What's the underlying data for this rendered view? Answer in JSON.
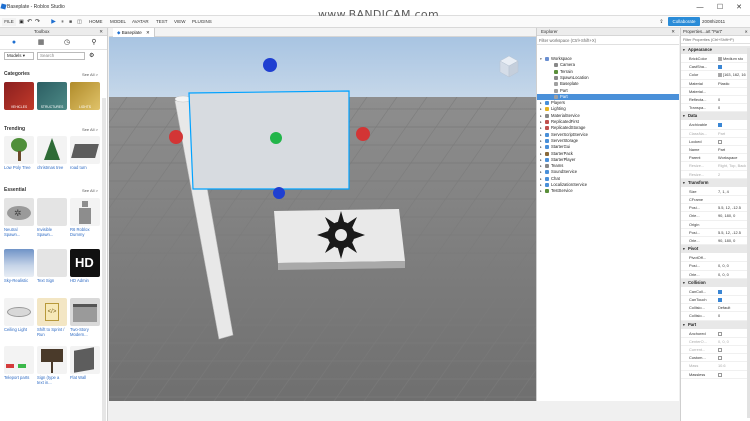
{
  "window": {
    "title": "Baseplate - Roblox Studio",
    "watermark": "www.BANDICAM.com",
    "min": "—",
    "max": "☐",
    "close": "✕"
  },
  "menubar": {
    "file": "FILE",
    "items": [
      "HOME",
      "MODEL",
      "AVATAR",
      "TEST",
      "VIEW",
      "PLUGINS"
    ],
    "collaborate": "Collaborate",
    "user": "2008hi2011"
  },
  "toolbox": {
    "title": "Toolbox",
    "close": "✕",
    "category_select": "Models",
    "search_placeholder": "Search",
    "sections": [
      {
        "title": "Categories",
        "see_all": "See All >"
      },
      {
        "title": "Trending",
        "see_all": "See All >"
      },
      {
        "title": "Essential",
        "see_all": "See All >"
      }
    ],
    "categories": [
      {
        "label": "VEHICLES",
        "color": "#b32b2b"
      },
      {
        "label": "STRUCTURES",
        "color": "#2f6f75"
      },
      {
        "label": "LIGHTS",
        "color": "#c9a43a"
      }
    ],
    "trending": [
      {
        "label": "Low Poly Tree"
      },
      {
        "label": "christmas tree"
      },
      {
        "label": "road turn"
      }
    ],
    "essential": [
      {
        "label": "Neutral Spawn..."
      },
      {
        "label": "Invisible Spawn..."
      },
      {
        "label": "R6 Roblox Dummy"
      },
      {
        "label": "Sky-Realistic"
      },
      {
        "label": "Text Sign"
      },
      {
        "label": "HD Admin"
      },
      {
        "label": "Ceiling Light"
      },
      {
        "label": "Shift to Sprint / Run"
      },
      {
        "label": "Two-Story Modern..."
      },
      {
        "label": "Teleport parts"
      },
      {
        "label": "Sign (type a text in..."
      },
      {
        "label": "Flat Wall"
      }
    ],
    "hd_badge": "HD"
  },
  "viewport": {
    "tab": "Baseplate",
    "tab_close": "✕"
  },
  "explorer": {
    "title": "Explorer",
    "close": "✕",
    "filter": "Filter workspace (Ctrl+Shift+X)",
    "items": [
      {
        "label": "Workspace",
        "depth": 0,
        "expanded": true,
        "color": "#6a8fd1"
      },
      {
        "label": "Camera",
        "depth": 1,
        "color": "#888888"
      },
      {
        "label": "Terrain",
        "depth": 1,
        "color": "#5a8f3a"
      },
      {
        "label": "SpawnLocation",
        "depth": 1,
        "color": "#888888"
      },
      {
        "label": "Baseplate",
        "depth": 1,
        "color": "#a0a0a0"
      },
      {
        "label": "Part",
        "depth": 1,
        "color": "#a0a0a0"
      },
      {
        "label": "Part",
        "depth": 1,
        "color": "#a0a0a0",
        "selected": true
      },
      {
        "label": "Players",
        "depth": 0,
        "color": "#4a90d9"
      },
      {
        "label": "Lighting",
        "depth": 0,
        "color": "#e6b422"
      },
      {
        "label": "MaterialService",
        "depth": 0,
        "color": "#888888"
      },
      {
        "label": "ReplicatedFirst",
        "depth": 0,
        "color": "#c0504d"
      },
      {
        "label": "ReplicatedStorage",
        "depth": 0,
        "color": "#c0504d"
      },
      {
        "label": "ServerScriptService",
        "depth": 0,
        "color": "#4a90d9"
      },
      {
        "label": "ServerStorage",
        "depth": 0,
        "color": "#4a90d9"
      },
      {
        "label": "StarterGui",
        "depth": 0,
        "color": "#4a90d9"
      },
      {
        "label": "StarterPack",
        "depth": 0,
        "color": "#8a6a3a"
      },
      {
        "label": "StarterPlayer",
        "depth": 0,
        "color": "#4a90d9"
      },
      {
        "label": "Teams",
        "depth": 0,
        "color": "#888888"
      },
      {
        "label": "SoundService",
        "depth": 0,
        "color": "#4a90d9"
      },
      {
        "label": "Chat",
        "depth": 0,
        "color": "#4a90d9"
      },
      {
        "label": "LocalizationService",
        "depth": 0,
        "color": "#4a90d9"
      },
      {
        "label": "TestService",
        "depth": 0,
        "color": "#5a8f3a"
      }
    ]
  },
  "properties": {
    "title": "Properties...art \"Part\"",
    "close": "✕",
    "filter": "Filter Properties (Ctrl+Shift+P)",
    "categories": [
      {
        "name": "Appearance",
        "rows": [
          {
            "name": "BrickColor",
            "value": "Medium sto",
            "swatch": "#a3a2a5"
          },
          {
            "name": "CastSha...",
            "value": "",
            "check": true
          },
          {
            "name": "Color",
            "value": "[163, 162, 16",
            "swatch": "#a3a2a5"
          },
          {
            "name": "Material",
            "value": "Plastic"
          },
          {
            "name": "Material...",
            "value": ""
          },
          {
            "name": "Reflecta...",
            "value": "0"
          },
          {
            "name": "Transpa...",
            "value": "0"
          }
        ]
      },
      {
        "name": "Data",
        "rows": [
          {
            "name": "Archivable",
            "value": "",
            "check": true
          },
          {
            "name": "ClassNa...",
            "value": "Part",
            "dim": true
          },
          {
            "name": "Locked",
            "value": "",
            "check": false
          },
          {
            "name": "Name",
            "value": "Part"
          },
          {
            "name": "Parent",
            "value": "Workspace"
          },
          {
            "name": "Resize...",
            "value": "Right, Top, Back",
            "dim": true
          },
          {
            "name": "Resize...",
            "value": "2",
            "dim": true
          }
        ]
      },
      {
        "name": "Transform",
        "rows": [
          {
            "name": "Size",
            "value": "7, 1, 4"
          },
          {
            "name": "CFrame",
            "value": ""
          },
          {
            "name": "Posi...",
            "value": "5.5, 12, -12.5"
          },
          {
            "name": "Orie...",
            "value": "90, 180, 0"
          },
          {
            "name": "Origin",
            "value": ""
          },
          {
            "name": "Posi...",
            "value": "5.5, 12, -12.5"
          },
          {
            "name": "Orie...",
            "value": "90, 180, 0"
          }
        ]
      },
      {
        "name": "Pivot",
        "rows": [
          {
            "name": "PivotOff...",
            "value": ""
          },
          {
            "name": "Posi...",
            "value": "0, 0, 0"
          },
          {
            "name": "Orie...",
            "value": "0, 0, 0"
          }
        ]
      },
      {
        "name": "Collision",
        "rows": [
          {
            "name": "CanColl...",
            "value": "",
            "check": true
          },
          {
            "name": "CanTouch",
            "value": "",
            "check": true
          },
          {
            "name": "Collisio...",
            "value": "Default"
          },
          {
            "name": "Collisio...",
            "value": "0"
          }
        ]
      },
      {
        "name": "Part",
        "rows": [
          {
            "name": "Anchored",
            "value": "",
            "check": false
          },
          {
            "name": "CenterO...",
            "value": "0, 0, 0",
            "dim": true
          },
          {
            "name": "Current...",
            "value": "",
            "check": false,
            "dim": true
          },
          {
            "name": "Custom...",
            "value": "",
            "check": false
          },
          {
            "name": "Mass",
            "value": "10.6",
            "dim": true
          },
          {
            "name": "Massless",
            "value": "",
            "check": false
          }
        ]
      }
    ]
  },
  "colors": {
    "accent": "#2a8cd8",
    "selection": "#4a90d9",
    "selection_outline": "#00a2ff"
  }
}
